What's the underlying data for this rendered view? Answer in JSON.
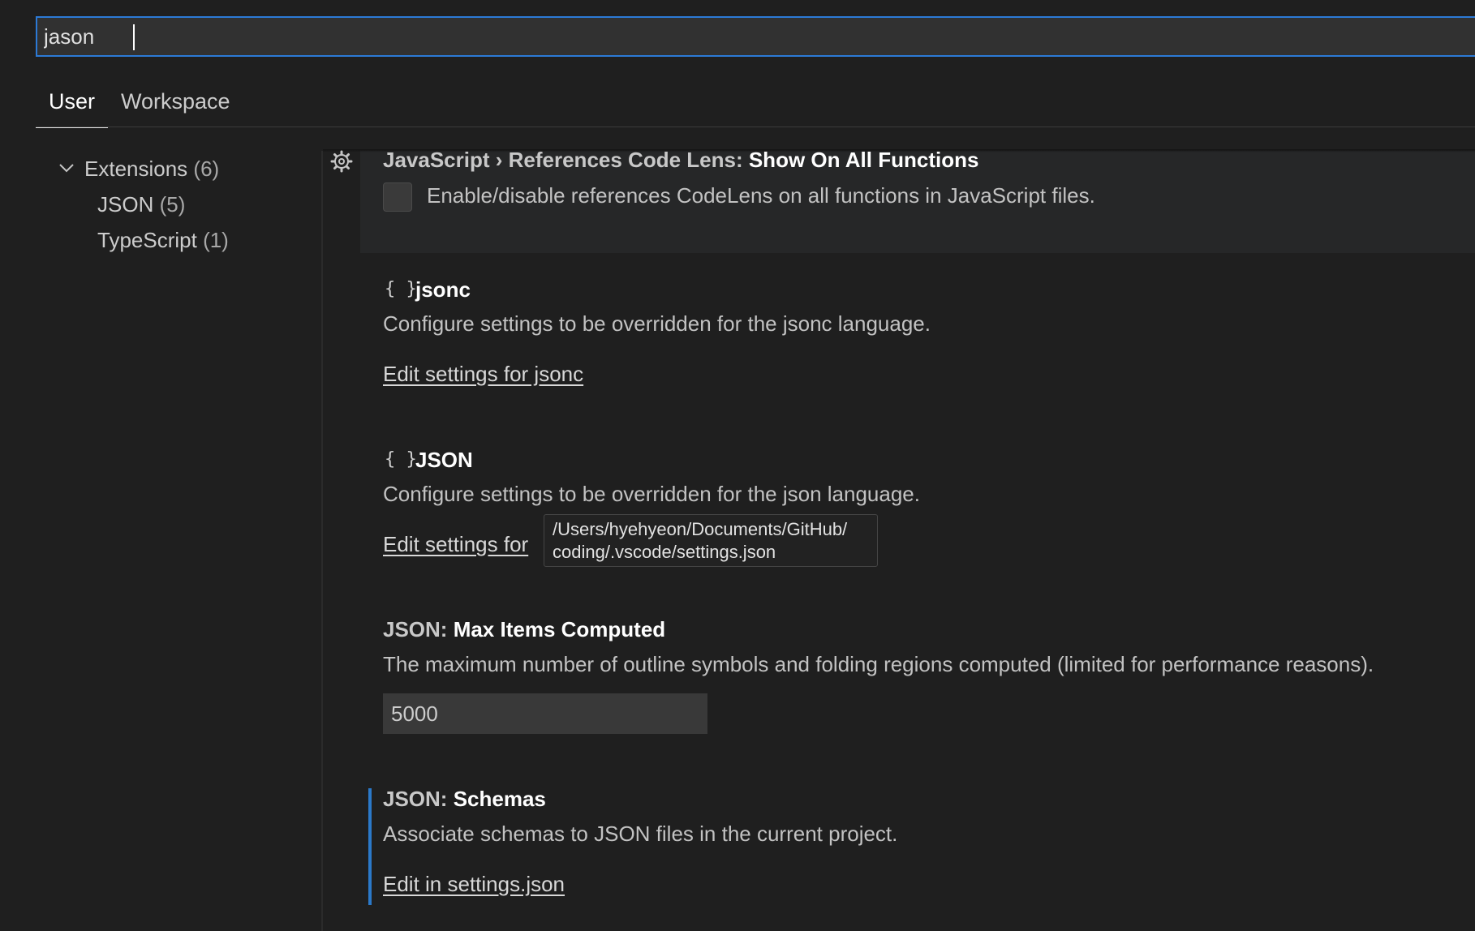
{
  "search": {
    "value": "jason"
  },
  "tabs": [
    {
      "label": "User",
      "active": true
    },
    {
      "label": "Workspace",
      "active": false
    }
  ],
  "toc": {
    "items": [
      {
        "label": "Extensions",
        "count": "(6)"
      },
      {
        "label": "JSON",
        "count": "(5)"
      },
      {
        "label": "TypeScript",
        "count": "(1)"
      }
    ]
  },
  "settings": {
    "references_code_lens": {
      "category": "JavaScript › References Code Lens: ",
      "name": "Show On All Functions",
      "description": "Enable/disable references CodeLens on all functions in JavaScript files.",
      "checked": false
    },
    "jsonc": {
      "braces": "{ }",
      "title": "jsonc",
      "description": "Configure settings to be overridden for the jsonc language.",
      "link": "Edit settings for jsonc"
    },
    "json": {
      "braces": "{ }",
      "title": "JSON",
      "description": "Configure settings to be overridden for the json language.",
      "link": "Edit settings for"
    },
    "max_items": {
      "category": "JSON: ",
      "name": "Max Items Computed",
      "description": "The maximum number of outline symbols and folding regions computed (limited for performance reasons).",
      "value": "5000"
    },
    "schemas": {
      "category": "JSON: ",
      "name": "Schemas",
      "description": "Associate schemas to JSON files in the current project.",
      "link": "Edit in settings.json"
    }
  },
  "tooltip": {
    "line1": "/Users/hyehyeon/Documents/GitHub/",
    "line2": "coding/.vscode/settings.json"
  },
  "colors": {
    "background": "#1f1f1f",
    "focus_border": "#2c7ad6",
    "modified_indicator": "#2b79c9"
  }
}
